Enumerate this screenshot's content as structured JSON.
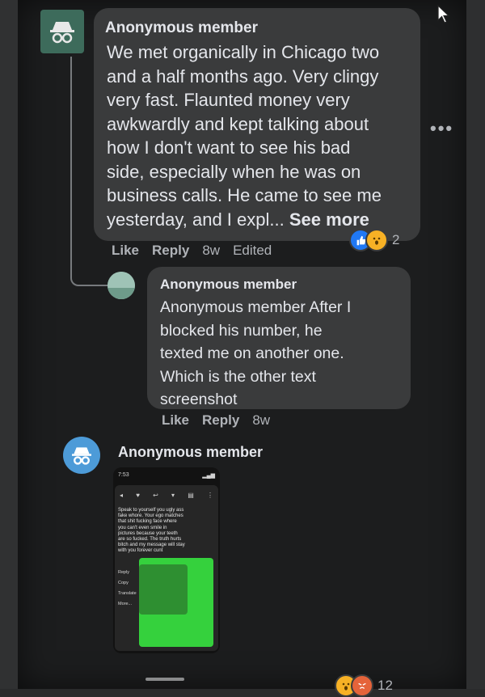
{
  "comment_main": {
    "author": "Anonymous member",
    "lines": [
      "We met organically in Chicago two",
      "and a half months ago. Very clingy",
      "very fast. Flaunted money very",
      "awkwardly and kept talking about",
      "how I don't want to see his bad",
      "side, especially when he was on",
      "business calls. He came to see me"
    ],
    "last_line": "yesterday, and I expl...",
    "see_more": "See more",
    "actions": {
      "like": "Like",
      "reply": "Reply",
      "time": "8w",
      "edited": "Edited"
    },
    "reaction_count": "2"
  },
  "comment_reply": {
    "author": "Anonymous member",
    "lines": [
      "Anonymous member After I",
      "blocked his number, he",
      "texted me on another one.",
      "Which is the other text",
      "screenshot"
    ],
    "actions": {
      "like": "Like",
      "reply": "Reply",
      "time": "8w"
    }
  },
  "comment_third": {
    "author": "Anonymous member",
    "attachment": {
      "status_time": "7:53",
      "message_lines": [
        "Speak to yourself you ugly ass",
        "fake whore. Your ego matches",
        "that shit fucking face where",
        "you can't even smile in",
        "pictures because your teeth",
        "are so fucked. The truth hurts",
        "bitch and my message will stay",
        "with you forever cunt"
      ],
      "menu": [
        "Reply",
        "Copy",
        "Translate",
        "More..."
      ]
    },
    "reaction_count": "12"
  },
  "colors": {
    "bubble": "#3a3b3c",
    "text": "#e4e6eb",
    "muted": "#b0b3b8",
    "like_blue": "#2078f4",
    "wow_yellow": "#f7b125"
  },
  "icons": [
    "incognito-avatar",
    "cursor-arrow",
    "more-dots-icon",
    "like-reaction",
    "wow-reaction",
    "angry-reaction"
  ]
}
